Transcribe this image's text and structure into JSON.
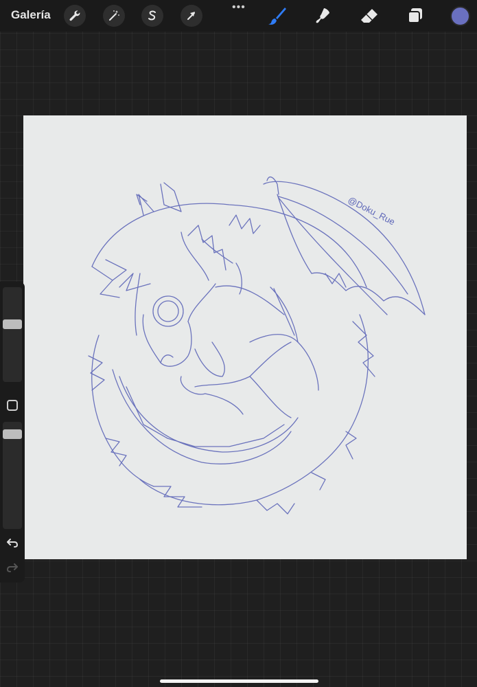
{
  "toolbar": {
    "gallery_label": "Galería",
    "left_tools": [
      "wrench-icon",
      "magic-wand-icon",
      "selection-icon",
      "transform-arrow-icon"
    ],
    "more_label": "•••",
    "right_tools": [
      "brush-icon",
      "smudge-icon",
      "eraser-icon",
      "layers-icon"
    ],
    "active_tool": "brush-icon",
    "accent_color": "#2f7cf6",
    "current_color": "#6a70c0"
  },
  "canvas": {
    "background": "#e8eaea",
    "stroke_color": "#5d66b8",
    "signature_text": "@Doku_Rue"
  },
  "sidebar": {
    "brush_size_level": 0.38,
    "opacity_level": 0.08
  }
}
